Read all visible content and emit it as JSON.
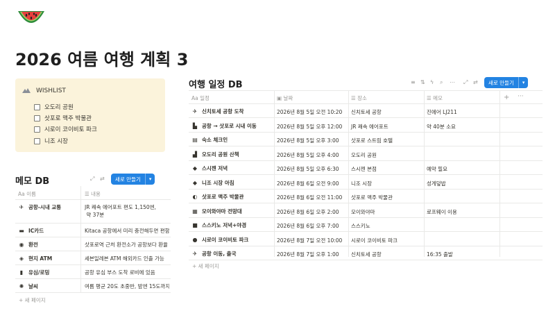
{
  "page": {
    "icon": "watermelon-icon",
    "title": "2026 여름 여행 계획 3"
  },
  "wishlist": {
    "icon": "mountain-icon",
    "title": "WISHLIST",
    "items": [
      "오도리 공원",
      "삿포로 맥주 박물관",
      "시로이 코이비토 파크",
      "니조 시장"
    ]
  },
  "memo_db": {
    "title": "메모 DB",
    "new_button": "새로 만들기",
    "columns": [
      "이름",
      "내용"
    ],
    "column_icons": [
      "Aa",
      "lines-icon"
    ],
    "rows": [
      {
        "icon": "✈",
        "name": "공항-시내 교통",
        "note": [
          "JR 쾌속 에어포트 편도 1,150엔,",
          "약 37분"
        ]
      },
      {
        "icon": "▬",
        "name": "IC카드",
        "note": [
          "Kitaca 공항에서 미리 충전해두면 편함"
        ]
      },
      {
        "icon": "◉",
        "name": "환전",
        "note": [
          "삿포로역 근처 환전소가 공항보다 환율"
        ]
      },
      {
        "icon": "◈",
        "name": "현지 ATM",
        "note": [
          "세븐일레븐 ATM 해외카드 인출 가능"
        ]
      },
      {
        "icon": "▮",
        "name": "유심/로밍",
        "note": [
          "공항 유심 부스 도착 로비에 있음"
        ]
      },
      {
        "icon": "✺",
        "name": "날씨",
        "note": [
          "여름 평균 20도 초중반, 밤엔 15도까지"
        ]
      }
    ],
    "add_page": "+ 새 페이지"
  },
  "trip_db": {
    "title": "여행 일정 DB",
    "new_button": "새로 만들기",
    "columns": [
      "일정",
      "날짜",
      "장소",
      "메모"
    ],
    "column_icons": [
      "Aa",
      "calendar-icon",
      "lines-icon",
      "lines-icon"
    ],
    "rows": [
      {
        "icon": "✈",
        "name": "신치토세 공항 도착",
        "date": "2026년 8월 5일 오전 10:20",
        "place": "신치토세 공항",
        "memo": "진에어 LJ211"
      },
      {
        "icon": "▙",
        "name": "공항 → 삿포로 시내 이동",
        "date": "2026년 8월 5일 오후 12:00",
        "place": "JR 쾌속 에어포트",
        "memo": "약 40분 소요"
      },
      {
        "icon": "▤",
        "name": "숙소 체크인",
        "date": "2026년 8월 5일 오후 3:00",
        "place": "삿포로 스트림 호텔",
        "memo": ""
      },
      {
        "icon": "▟",
        "name": "오도리 공원 산책",
        "date": "2026년 8월 5일 오후 4:00",
        "place": "오도리 공원",
        "memo": ""
      },
      {
        "icon": "◆",
        "name": "스시젠 저녁",
        "date": "2026년 8월 5일 오후 6:30",
        "place": "스시젠 본점",
        "memo": "예약 필요"
      },
      {
        "icon": "◆",
        "name": "니조 시장 아침",
        "date": "2026년 8월 6일 오전 9:00",
        "place": "니조 시장",
        "memo": "성게덮밥"
      },
      {
        "icon": "◐",
        "name": "삿포로 맥주 박물관",
        "date": "2026년 8월 6일 오전 11:00",
        "place": "삿포로 맥주 박물관",
        "memo": ""
      },
      {
        "icon": "▦",
        "name": "모이와야마 전망대",
        "date": "2026년 8월 6일 오후 2:00",
        "place": "모이와야마",
        "memo": "로프웨이 이용"
      },
      {
        "icon": "■",
        "name": "스스키노 저녁+야경",
        "date": "2026년 8월 6일 오후 7:00",
        "place": "스스키노",
        "memo": ""
      },
      {
        "icon": "●",
        "name": "시로이 코이비토 파크",
        "date": "2026년 8월 7일 오전 10:00",
        "place": "시로이 코이비토 파크",
        "memo": ""
      },
      {
        "icon": "✈",
        "name": "공항 이동, 출국",
        "date": "2026년 8월 7일 오후 1:00",
        "place": "신치토세 공항",
        "memo": "16:35 출발"
      }
    ],
    "add_page": "+ 새 페이지"
  },
  "colors": {
    "accent": "#2383e2",
    "callout_bg": "#fbf3db",
    "text": "#37352f",
    "muted": "#9b9a97"
  }
}
